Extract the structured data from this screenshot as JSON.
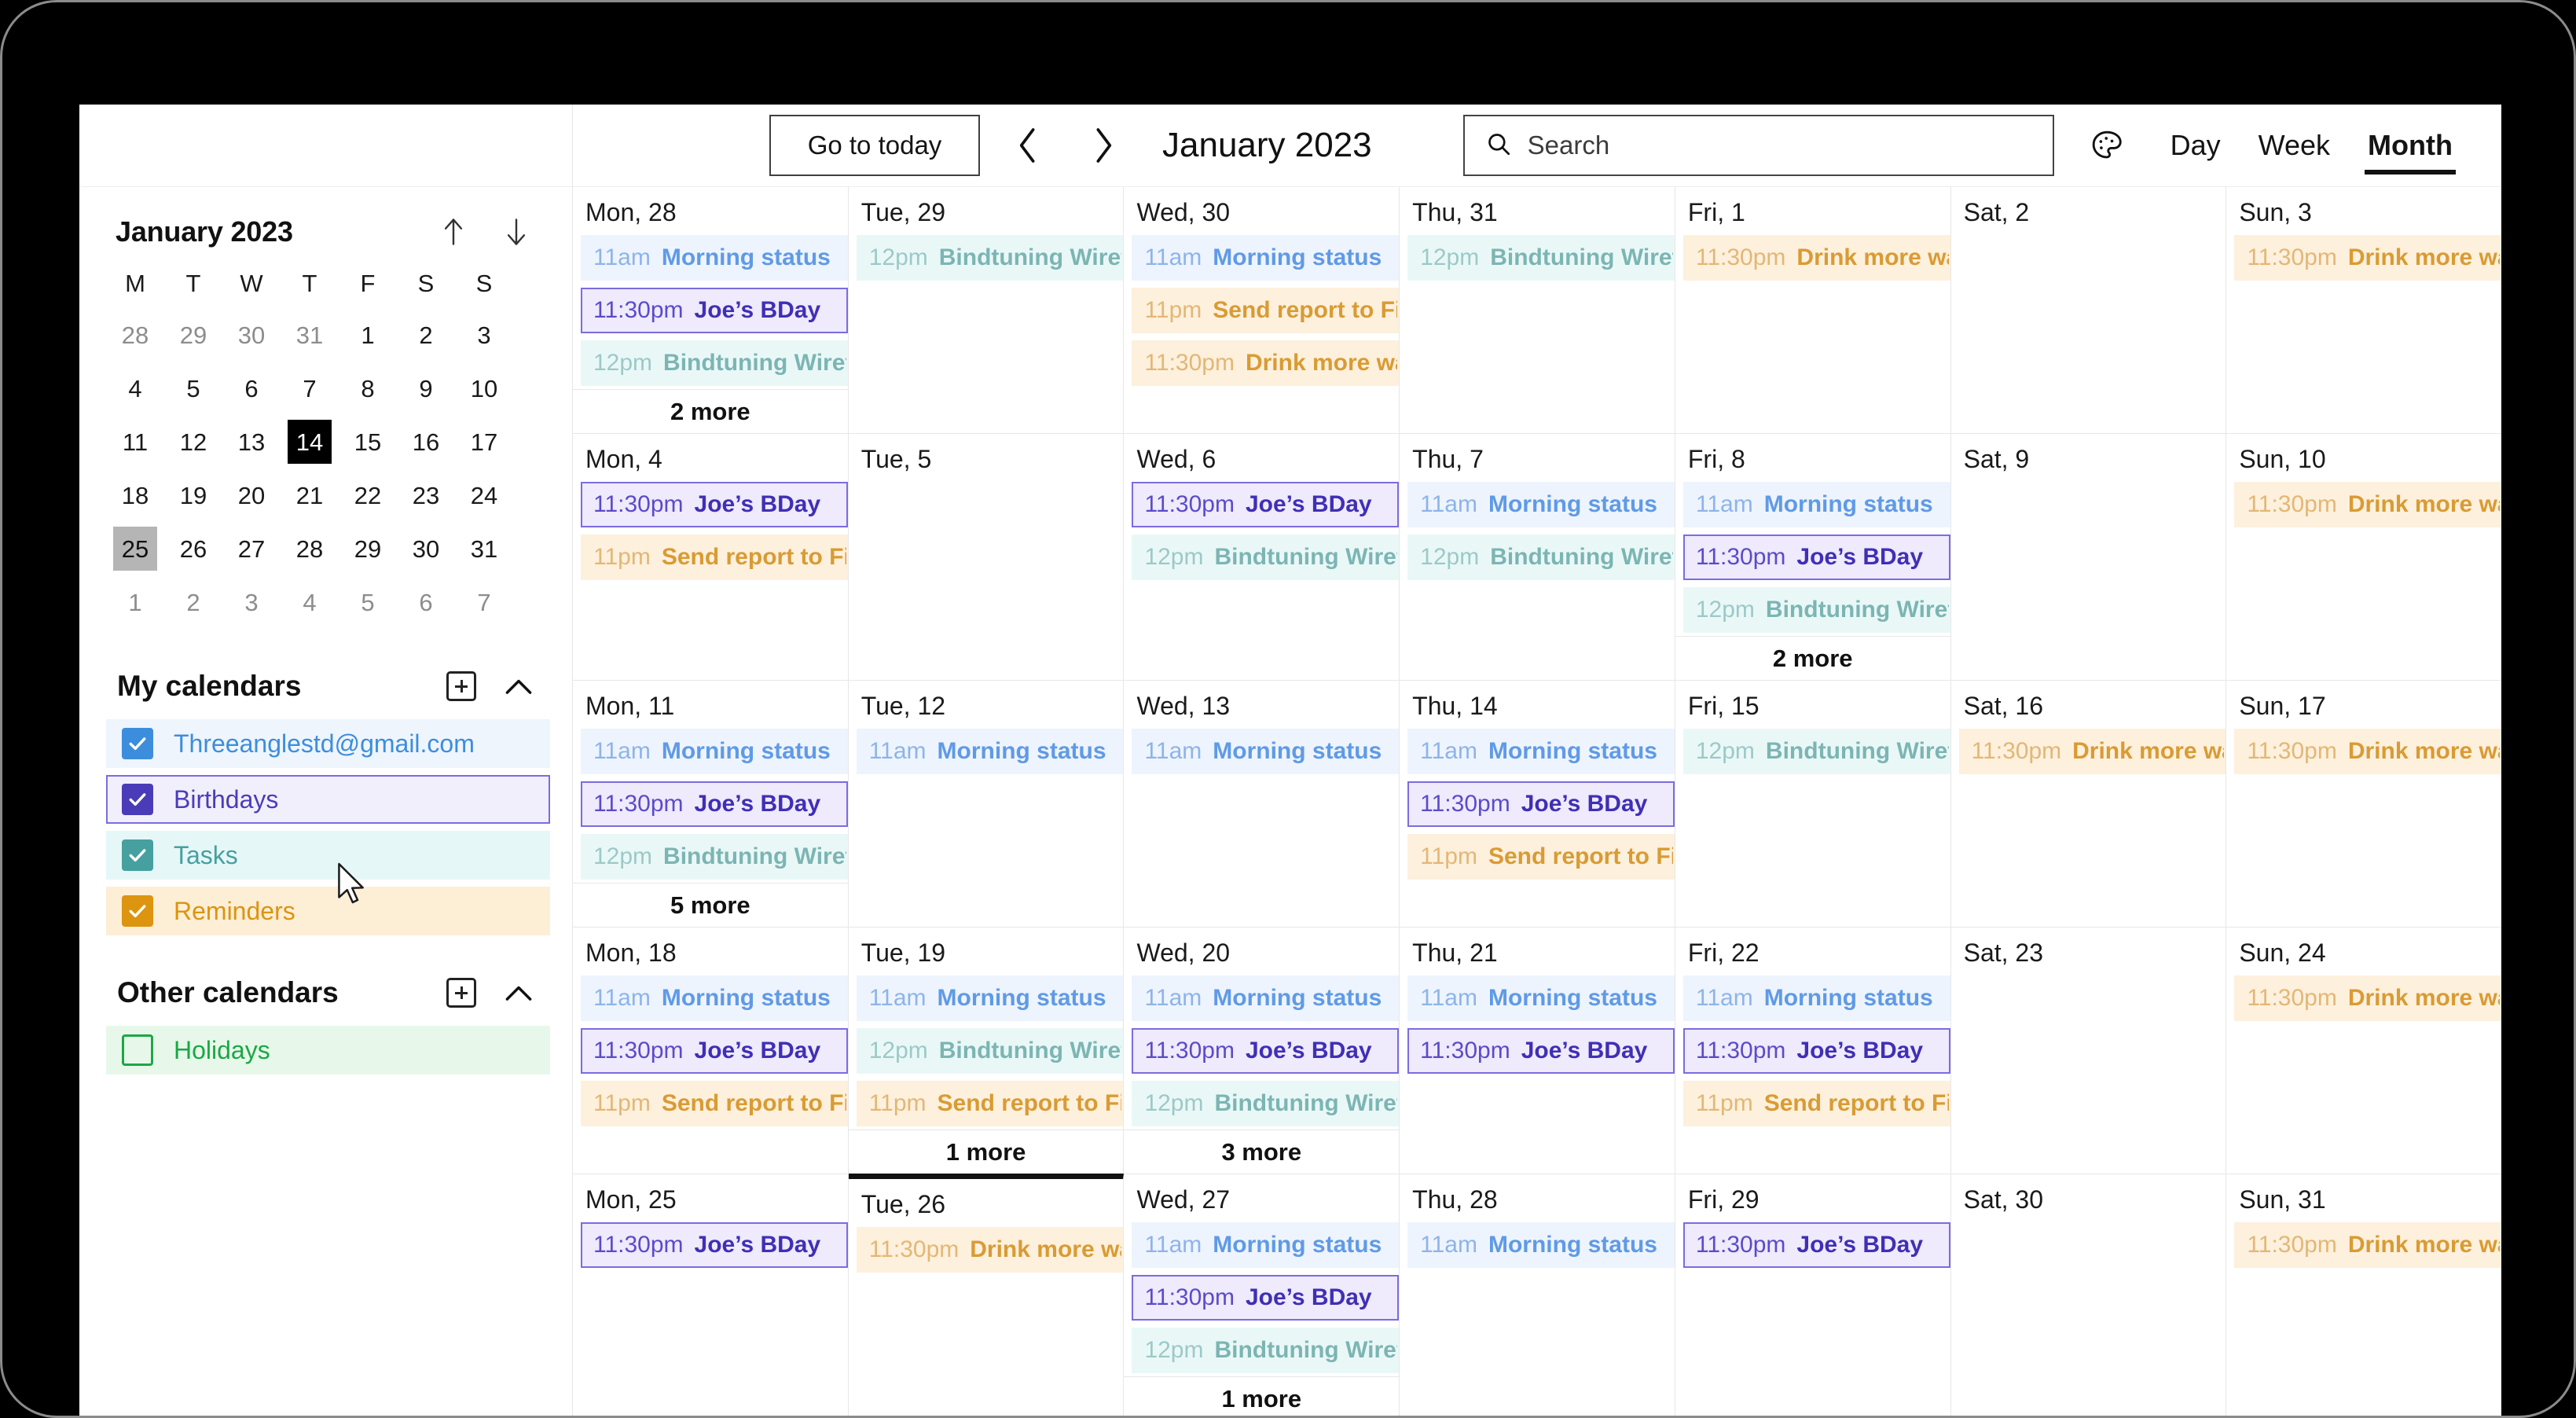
{
  "app": {
    "title": "Calendar"
  },
  "toolbar": {
    "today_label": "Go to today",
    "prev_icon": "chevron-left-icon",
    "next_icon": "chevron-right-icon",
    "period_title": "January 2023",
    "search_placeholder": "Search",
    "search_value": "",
    "search_icon": "search-icon",
    "theme_icon": "palette-icon",
    "views": [
      {
        "label": "Day",
        "active": false
      },
      {
        "label": "Week",
        "active": false
      },
      {
        "label": "Month",
        "active": true
      }
    ]
  },
  "sidebar": {
    "mini_calendar": {
      "title": "January 2023",
      "up_icon": "arrow-up-icon",
      "down_icon": "arrow-down-icon",
      "weekday_initials": [
        "M",
        "T",
        "W",
        "T",
        "F",
        "S",
        "S"
      ],
      "weeks": [
        [
          {
            "d": "28",
            "m": true
          },
          {
            "d": "29",
            "m": true
          },
          {
            "d": "30",
            "m": true
          },
          {
            "d": "31",
            "m": true
          },
          {
            "d": "1"
          },
          {
            "d": "2"
          },
          {
            "d": "3"
          }
        ],
        [
          {
            "d": "4"
          },
          {
            "d": "5"
          },
          {
            "d": "6"
          },
          {
            "d": "7"
          },
          {
            "d": "8"
          },
          {
            "d": "9"
          },
          {
            "d": "10"
          }
        ],
        [
          {
            "d": "11"
          },
          {
            "d": "12"
          },
          {
            "d": "13"
          },
          {
            "d": "14",
            "sel": true
          },
          {
            "d": "15"
          },
          {
            "d": "16"
          },
          {
            "d": "17"
          }
        ],
        [
          {
            "d": "18"
          },
          {
            "d": "19"
          },
          {
            "d": "20"
          },
          {
            "d": "21"
          },
          {
            "d": "22"
          },
          {
            "d": "23"
          },
          {
            "d": "24"
          }
        ],
        [
          {
            "d": "25",
            "today": true
          },
          {
            "d": "26"
          },
          {
            "d": "27"
          },
          {
            "d": "28"
          },
          {
            "d": "29"
          },
          {
            "d": "30"
          },
          {
            "d": "31"
          }
        ],
        [
          {
            "d": "1",
            "m": true
          },
          {
            "d": "2",
            "m": true
          },
          {
            "d": "3",
            "m": true
          },
          {
            "d": "4",
            "m": true
          },
          {
            "d": "5",
            "m": true
          },
          {
            "d": "6",
            "m": true
          },
          {
            "d": "7",
            "m": true
          }
        ]
      ]
    },
    "groups": [
      {
        "title": "My calendars",
        "add_icon": "plus-square-icon",
        "collapse_icon": "chevron-up-icon",
        "items": [
          {
            "label": "Threeanglestd@gmail.com",
            "checked": true,
            "color": "#3d8ddd",
            "row_bg": "#eef5fd",
            "text_color": "#3d8ddd",
            "hover": false
          },
          {
            "label": "Birthdays",
            "checked": true,
            "color": "#4a3cb8",
            "row_bg": "#f2effd",
            "text_color": "#4a3cb8",
            "hover": true
          },
          {
            "label": "Tasks",
            "checked": true,
            "color": "#47a0a0",
            "row_bg": "#e6f7f8",
            "text_color": "#47a0a0",
            "hover": false
          },
          {
            "label": "Reminders",
            "checked": true,
            "color": "#dd940f",
            "row_bg": "#fdeed6",
            "text_color": "#dd940f",
            "hover": false
          }
        ]
      },
      {
        "title": "Other calendars",
        "add_icon": "plus-square-icon",
        "collapse_icon": "chevron-up-icon",
        "items": [
          {
            "label": "Holidays",
            "checked": false,
            "color": "#1aa845",
            "row_bg": "#e7f8ea",
            "text_color": "#1aa845",
            "hover": false
          }
        ]
      }
    ]
  },
  "grid": {
    "weeks": [
      {
        "days": [
          {
            "label": "Mon, 28",
            "more": "2 more",
            "events": [
              {
                "time": "11am",
                "name": "Morning status",
                "color": "c-blue"
              },
              {
                "time": "11:30pm",
                "name": "Joe’s BDay",
                "color": "c-purple"
              },
              {
                "time": "12pm",
                "name": "Bindtuning Wiref",
                "color": "c-teal"
              }
            ]
          },
          {
            "label": "Tue, 29",
            "events": [
              {
                "time": "12pm",
                "name": "Bindtuning Wiref",
                "color": "c-teal"
              }
            ]
          },
          {
            "label": "Wed, 30",
            "events": [
              {
                "time": "11am",
                "name": "Morning status",
                "color": "c-blue"
              },
              {
                "time": "11pm",
                "name": "Send report to Fi",
                "color": "c-orange"
              },
              {
                "time": "11:30pm",
                "name": "Drink more wa",
                "color": "c-orange"
              }
            ]
          },
          {
            "label": "Thu, 31",
            "events": [
              {
                "time": "12pm",
                "name": "Bindtuning Wiref",
                "color": "c-teal"
              }
            ]
          },
          {
            "label": "Fri, 1",
            "events": [
              {
                "time": "11:30pm",
                "name": "Drink more wa",
                "color": "c-orange"
              }
            ]
          },
          {
            "label": "Sat, 2",
            "events": []
          },
          {
            "label": "Sun, 3",
            "events": [
              {
                "time": "11:30pm",
                "name": "Drink more wa",
                "color": "c-orange"
              }
            ]
          }
        ]
      },
      {
        "days": [
          {
            "label": "Mon, 4",
            "events": [
              {
                "time": "11:30pm",
                "name": "Joe’s BDay",
                "color": "c-purple"
              },
              {
                "time": "11pm",
                "name": "Send report to Fi",
                "color": "c-orange"
              }
            ]
          },
          {
            "label": "Tue, 5",
            "events": []
          },
          {
            "label": "Wed, 6",
            "events": [
              {
                "time": "11:30pm",
                "name": "Joe’s BDay",
                "color": "c-purple"
              },
              {
                "time": "12pm",
                "name": "Bindtuning Wiref",
                "color": "c-teal"
              }
            ]
          },
          {
            "label": "Thu, 7",
            "events": [
              {
                "time": "11am",
                "name": "Morning status",
                "color": "c-blue"
              },
              {
                "time": "12pm",
                "name": "Bindtuning Wiref",
                "color": "c-teal"
              }
            ]
          },
          {
            "label": "Fri, 8",
            "more": "2 more",
            "events": [
              {
                "time": "11am",
                "name": "Morning status",
                "color": "c-blue"
              },
              {
                "time": "11:30pm",
                "name": "Joe’s BDay",
                "color": "c-purple"
              },
              {
                "time": "12pm",
                "name": "Bindtuning Wiref",
                "color": "c-teal"
              }
            ]
          },
          {
            "label": "Sat, 9",
            "events": []
          },
          {
            "label": "Sun, 10",
            "events": [
              {
                "time": "11:30pm",
                "name": "Drink more wa",
                "color": "c-orange"
              }
            ]
          }
        ]
      },
      {
        "days": [
          {
            "label": "Mon, 11",
            "more": "5 more",
            "events": [
              {
                "time": "11am",
                "name": "Morning status",
                "color": "c-blue"
              },
              {
                "time": "11:30pm",
                "name": "Joe’s BDay",
                "color": "c-purple"
              },
              {
                "time": "12pm",
                "name": "Bindtuning Wiref",
                "color": "c-teal"
              }
            ]
          },
          {
            "label": "Tue, 12",
            "events": [
              {
                "time": "11am",
                "name": "Morning status",
                "color": "c-blue"
              }
            ]
          },
          {
            "label": "Wed, 13",
            "events": [
              {
                "time": "11am",
                "name": "Morning status",
                "color": "c-blue"
              }
            ]
          },
          {
            "label": "Thu, 14",
            "events": [
              {
                "time": "11am",
                "name": "Morning status",
                "color": "c-blue"
              },
              {
                "time": "11:30pm",
                "name": "Joe’s BDay",
                "color": "c-purple"
              },
              {
                "time": "11pm",
                "name": "Send report to Fi",
                "color": "c-orange"
              }
            ]
          },
          {
            "label": "Fri, 15",
            "events": [
              {
                "time": "12pm",
                "name": "Bindtuning Wiref",
                "color": "c-teal"
              }
            ]
          },
          {
            "label": "Sat, 16",
            "events": [
              {
                "time": "11:30pm",
                "name": "Drink more wa",
                "color": "c-orange"
              }
            ]
          },
          {
            "label": "Sun, 17",
            "events": [
              {
                "time": "11:30pm",
                "name": "Drink more wa",
                "color": "c-orange"
              }
            ]
          }
        ]
      },
      {
        "days": [
          {
            "label": "Mon, 18",
            "events": [
              {
                "time": "11am",
                "name": "Morning status",
                "color": "c-blue"
              },
              {
                "time": "11:30pm",
                "name": "Joe’s BDay",
                "color": "c-purple"
              },
              {
                "time": "11pm",
                "name": "Send report to Fi",
                "color": "c-orange"
              }
            ]
          },
          {
            "label": "Tue, 19",
            "more": "1 more",
            "events": [
              {
                "time": "11am",
                "name": "Morning status",
                "color": "c-blue"
              },
              {
                "time": "12pm",
                "name": "Bindtuning Wiref",
                "color": "c-teal"
              },
              {
                "time": "11pm",
                "name": "Send report to Fi",
                "color": "c-orange"
              }
            ]
          },
          {
            "label": "Wed, 20",
            "more": "3 more",
            "events": [
              {
                "time": "11am",
                "name": "Morning status",
                "color": "c-blue"
              },
              {
                "time": "11:30pm",
                "name": "Joe’s BDay",
                "color": "c-purple"
              },
              {
                "time": "12pm",
                "name": "Bindtuning Wiref",
                "color": "c-teal"
              }
            ]
          },
          {
            "label": "Thu, 21",
            "events": [
              {
                "time": "11am",
                "name": "Morning status",
                "color": "c-blue"
              },
              {
                "time": "11:30pm",
                "name": "Joe’s BDay",
                "color": "c-purple"
              }
            ]
          },
          {
            "label": "Fri, 22",
            "events": [
              {
                "time": "11am",
                "name": "Morning status",
                "color": "c-blue"
              },
              {
                "time": "11:30pm",
                "name": "Joe’s BDay",
                "color": "c-purple"
              },
              {
                "time": "11pm",
                "name": "Send report to Fi",
                "color": "c-orange"
              }
            ]
          },
          {
            "label": "Sat, 23",
            "events": []
          },
          {
            "label": "Sun, 24",
            "events": [
              {
                "time": "11:30pm",
                "name": "Drink more wa",
                "color": "c-orange"
              }
            ]
          }
        ]
      },
      {
        "days": [
          {
            "label": "Mon, 25",
            "events": [
              {
                "time": "11:30pm",
                "name": "Joe’s BDay",
                "color": "c-purple"
              }
            ]
          },
          {
            "label": "Tue, 26",
            "topmark": true,
            "events": [
              {
                "time": "11:30pm",
                "name": "Drink more wa",
                "color": "c-orange"
              }
            ]
          },
          {
            "label": "Wed, 27",
            "more": "1 more",
            "events": [
              {
                "time": "11am",
                "name": "Morning status",
                "color": "c-blue"
              },
              {
                "time": "11:30pm",
                "name": "Joe’s BDay",
                "color": "c-purple"
              },
              {
                "time": "12pm",
                "name": "Bindtuning Wiref",
                "color": "c-teal"
              }
            ]
          },
          {
            "label": "Thu, 28",
            "events": [
              {
                "time": "11am",
                "name": "Morning status",
                "color": "c-blue"
              }
            ]
          },
          {
            "label": "Fri, 29",
            "events": [
              {
                "time": "11:30pm",
                "name": "Joe’s BDay",
                "color": "c-purple"
              }
            ]
          },
          {
            "label": "Sat, 30",
            "events": []
          },
          {
            "label": "Sun, 31",
            "events": [
              {
                "time": "11:30pm",
                "name": "Drink more wa",
                "color": "c-orange"
              }
            ]
          }
        ]
      }
    ]
  }
}
